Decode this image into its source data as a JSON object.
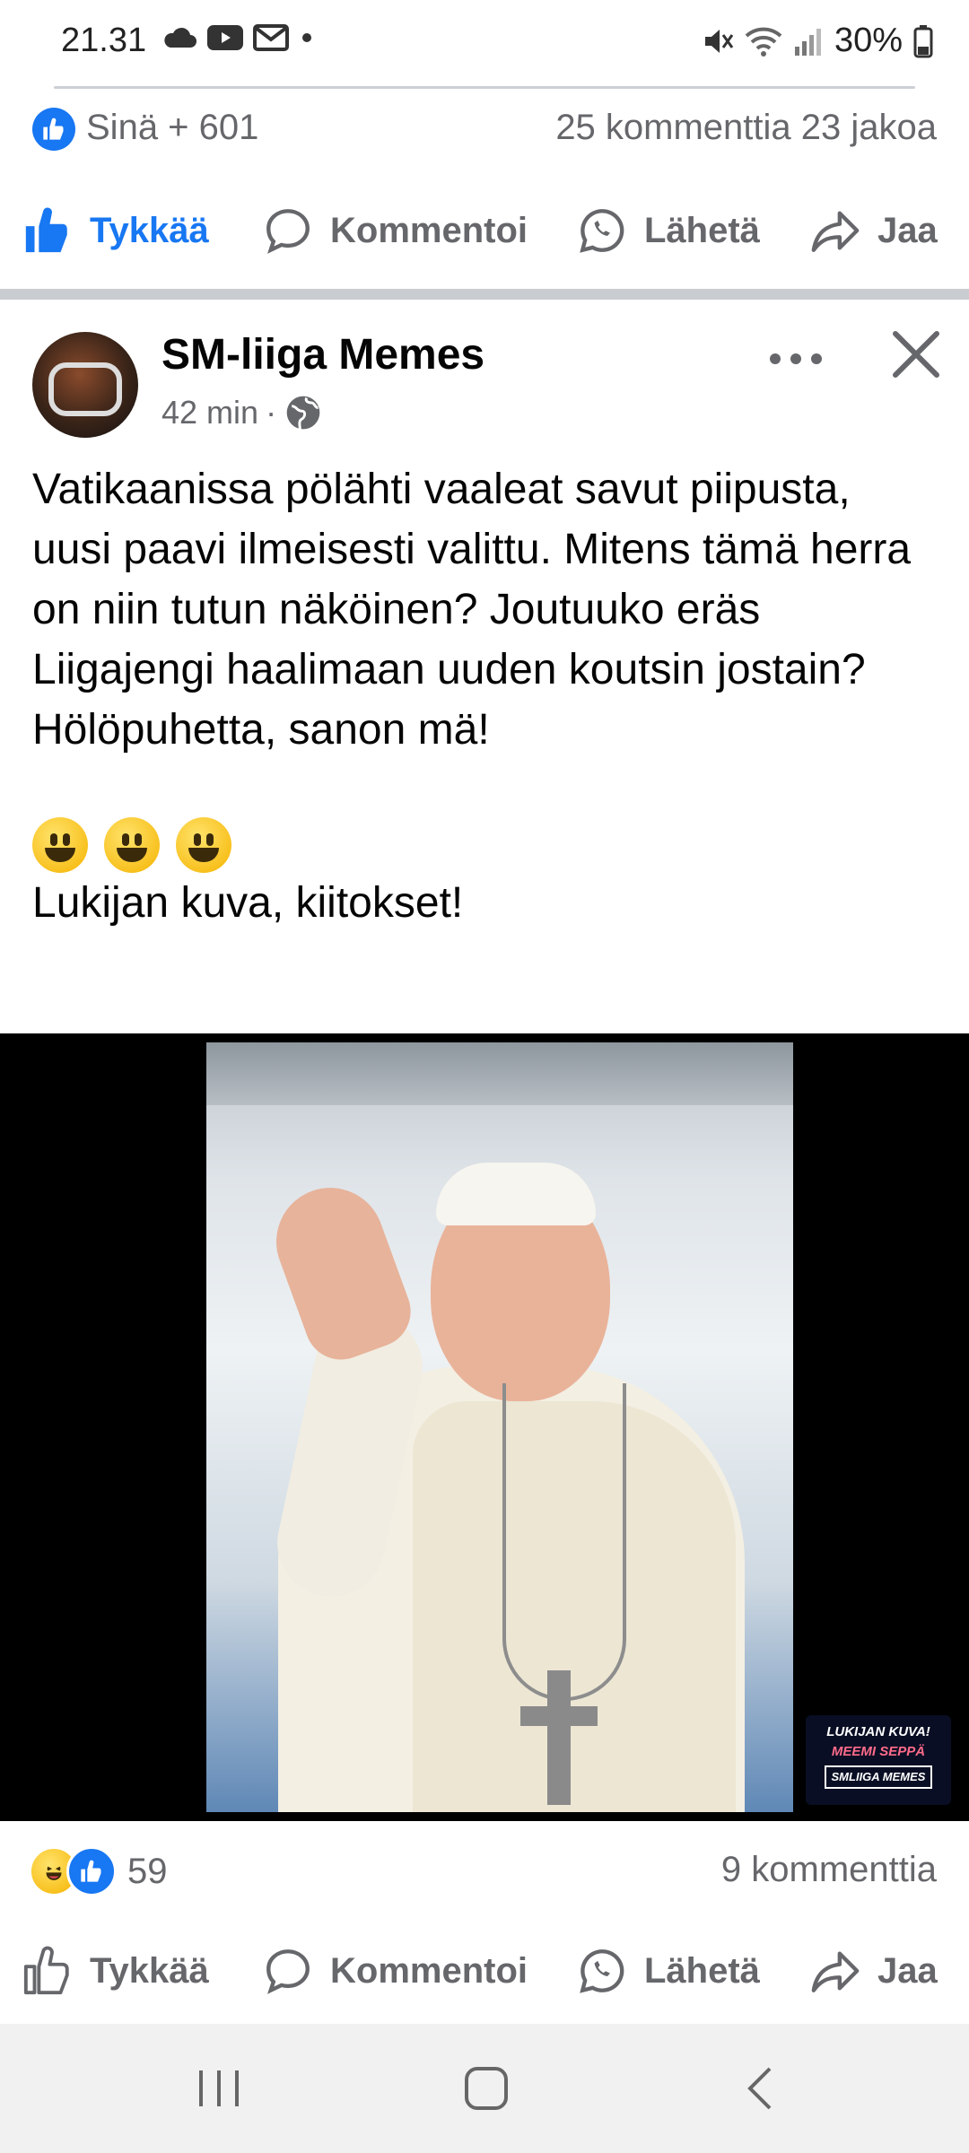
{
  "status_bar": {
    "time": "21.31",
    "battery": "30%"
  },
  "previous_post": {
    "reactions_text": "Sinä + 601",
    "stats_right": "25 kommenttia  23 jakoa",
    "actions": {
      "like": "Tykkää",
      "comment": "Kommentoi",
      "send": "Lähetä",
      "share": "Jaa"
    }
  },
  "post": {
    "page_name": "SM-liiga Memes",
    "time_ago": "42 min",
    "meta_separator": "·",
    "text": "Vatikaanissa pölähti vaaleat savut piipusta, uusi paavi ilmeisesti valittu. Mitens tämä herra on niin tutun näköinen? Joutuuko eräs Liigajengi haalimaan uuden koutsin jostain? Hölöpuhetta, sanon mä!",
    "credit": "Lukijan kuva, kiitokset!",
    "watermark": {
      "line1": "LUKIJAN KUVA!",
      "line2": "MEEMI SEPPÄ",
      "tag": "SMLIIGA MEMES"
    },
    "reaction_count": "59",
    "comment_count": "9 kommenttia",
    "actions": {
      "like": "Tykkää",
      "comment": "Kommentoi",
      "send": "Lähetä",
      "share": "Jaa"
    }
  },
  "colors": {
    "facebook_blue": "#1877f2",
    "secondary_text": "#65676b",
    "separator": "#c9ccd1"
  },
  "icons": [
    "cloud-icon",
    "youtube-icon",
    "gmail-icon",
    "mute-icon",
    "wifi-icon",
    "signal-icon",
    "battery-icon",
    "globe-icon",
    "more-icon",
    "close-icon",
    "like-icon",
    "comment-icon",
    "whatsapp-icon",
    "share-icon",
    "recent-apps-icon",
    "home-icon",
    "back-icon"
  ]
}
